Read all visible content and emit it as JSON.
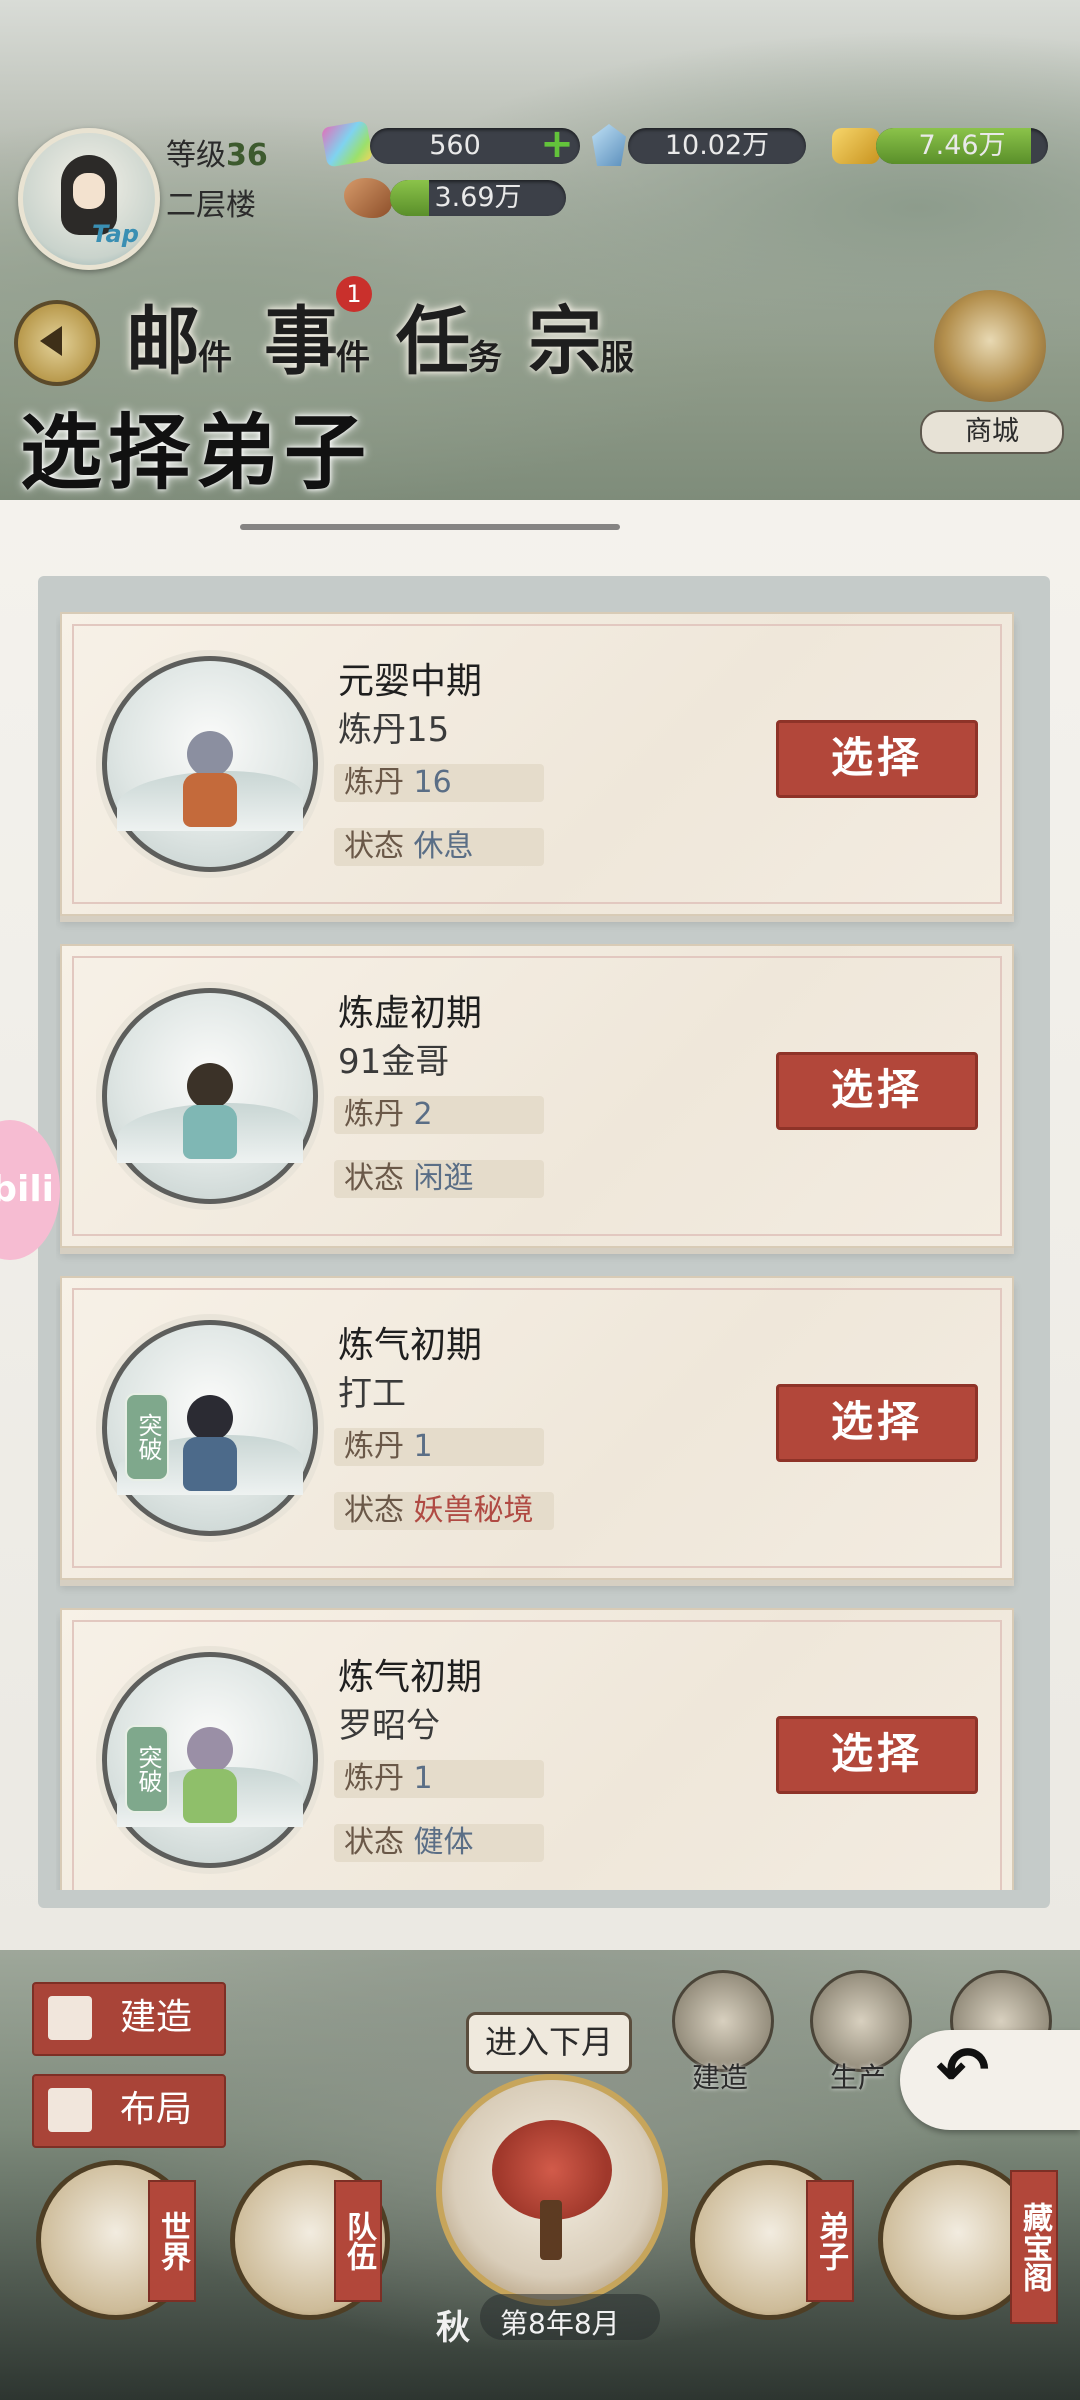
{
  "header": {
    "avatar_tap": "Tap",
    "level_label": "等级",
    "level_value": "36",
    "floor": "二层楼",
    "resources": {
      "gem": "560",
      "crystal": "10.02万",
      "gold": "7.46万",
      "ore": "3.69万"
    }
  },
  "nav": {
    "mail": {
      "main": "邮",
      "sub": "件"
    },
    "events": {
      "main": "事",
      "sub": "件",
      "badge": "1"
    },
    "tasks": {
      "main": "任",
      "sub": "务"
    },
    "sect_clothes": {
      "main": "宗",
      "sub": "服"
    },
    "shop": "商城"
  },
  "panel": {
    "title": "选择弟子"
  },
  "disciples": [
    {
      "realm": "元婴中期",
      "name": "炼丹15",
      "skill_label": "炼丹",
      "skill_value": "16",
      "state_label": "状态",
      "state_value": "休息",
      "select": "选择"
    },
    {
      "realm": "炼虚初期",
      "name": "91金哥",
      "skill_label": "炼丹",
      "skill_value": "2",
      "state_label": "状态",
      "state_value": "闲逛",
      "select": "选择"
    },
    {
      "realm": "炼气初期",
      "name": "打工",
      "skill_label": "炼丹",
      "skill_value": "1",
      "state_label": "状态",
      "state_value": "妖兽秘境",
      "select": "选择",
      "breakthrough": "突破"
    },
    {
      "realm": "炼气初期",
      "name": "罗昭兮",
      "skill_label": "炼丹",
      "skill_value": "1",
      "state_label": "状态",
      "state_value": "健体",
      "select": "选择",
      "breakthrough": "突破"
    }
  ],
  "side_tab": "bili",
  "bottom": {
    "build": "建造",
    "layout": "布局",
    "next_month": "进入下月",
    "season": "秋",
    "date": "第8年8月",
    "build_round": "建造",
    "produce_round": "生产",
    "world": "世界",
    "team": "队伍",
    "disciples": "弟子",
    "treasury": "藏宝阁"
  },
  "colors": {
    "accent_red": "#b2473a",
    "state_red": "#b04a43",
    "value_blue": "#5a6e86"
  }
}
